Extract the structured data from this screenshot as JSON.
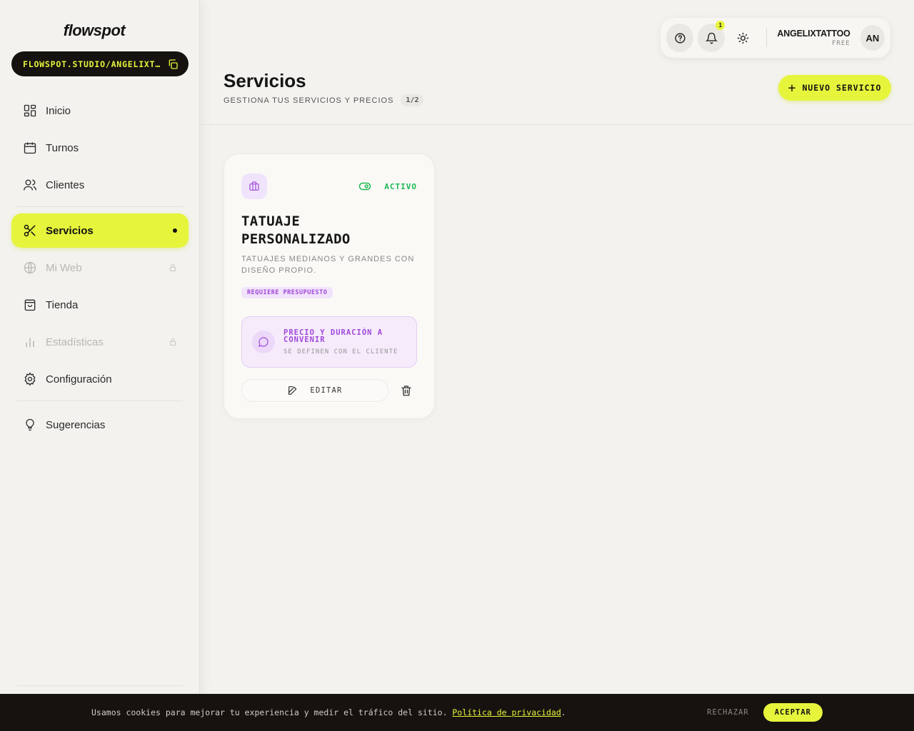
{
  "sidebar": {
    "logo": "flowspot",
    "url": "FLOWSPOT.STUDIO/ANGELIXTATTOO",
    "items": [
      {
        "label": "Inicio",
        "icon": "dashboard-icon"
      },
      {
        "label": "Turnos",
        "icon": "calendar-icon"
      },
      {
        "label": "Clientes",
        "icon": "users-icon"
      },
      {
        "label": "Servicios",
        "icon": "scissors-icon",
        "active": true
      },
      {
        "label": "Mi Web",
        "icon": "globe-icon",
        "locked": true
      },
      {
        "label": "Tienda",
        "icon": "shopping-bag-icon"
      },
      {
        "label": "Estadísticas",
        "icon": "bar-chart-icon",
        "locked": true
      },
      {
        "label": "Configuración",
        "icon": "gear-icon"
      },
      {
        "label": "Sugerencias",
        "icon": "lightbulb-icon"
      }
    ]
  },
  "topbar": {
    "notifications_count": "1",
    "user_name": "ANGELIXTATTOO",
    "plan": "FREE",
    "avatar": "AN"
  },
  "header": {
    "title": "Servicios",
    "subtitle": "GESTIONA TUS SERVICIOS Y PRECIOS",
    "count": "1/2",
    "new_button": "NUEVO SERVICIO"
  },
  "service_card": {
    "status": "ACTIVO",
    "title": "TATUAJE PERSONALIZADO",
    "description": "TATUAJES MEDIANOS Y GRANDES CON DISEÑO PROPIO.",
    "tag": "REQUIERE PRESUPUESTO",
    "info_title": "PRECIO Y DURACIÓN A CONVENIR",
    "info_sub": "SE DEFINEN CON EL CLIENTE",
    "edit_label": "EDITAR"
  },
  "cookie": {
    "message": "Usamos cookies para mejorar tu experiencia y medir el tráfico del sitio. ",
    "link": "Política de privacidad",
    "after": ".",
    "reject": "RECHAZAR",
    "accept": "ACEPTAR"
  },
  "colors": {
    "accent": "#e6f53c",
    "dark": "#16120f",
    "active_green": "#1db954",
    "purple": "#a148d8"
  }
}
